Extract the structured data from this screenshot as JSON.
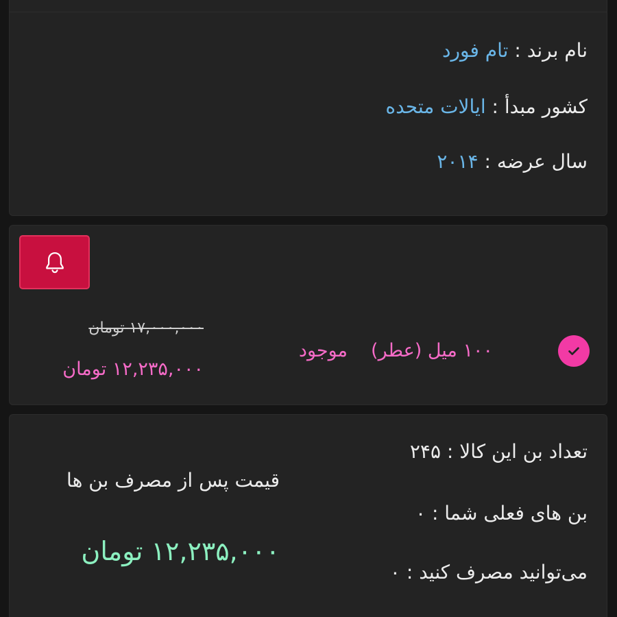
{
  "spec": {
    "brand_label": "نام برند :",
    "brand_value": "تام فورد",
    "country_label": "کشور مبدأ :",
    "country_value": "ایالات متحده",
    "year_label": "سال عرضه :",
    "year_value": "۲۰۱۴"
  },
  "variant": {
    "notify_icon": "bell-icon",
    "selected_icon": "check-circle-icon",
    "name": "۱۰۰ میل (عطر)",
    "status": "موجود",
    "old_price": "۱۷,۰۰۰,۰۰۰ تومان",
    "new_price": "۱۲,۲۳۵,۰۰۰ تومان",
    "colors": {
      "notify_bg": "#c8103f",
      "accent": "#f66bc8",
      "check_bg": "#f23aa5"
    }
  },
  "bon": {
    "count_label": "تعداد بن این کالا :",
    "count_value": "۲۴۵",
    "current_label": "بن های فعلی شما :",
    "current_value": "۰",
    "usable_label": "می‌توانید مصرف کنید :",
    "usable_value": "۰",
    "after_label": "قیمت پس از مصرف بن ها",
    "after_price": "۱۲,۲۳۵,۰۰۰ تومان",
    "colors": {
      "after_price": "#8cf0c0"
    }
  }
}
